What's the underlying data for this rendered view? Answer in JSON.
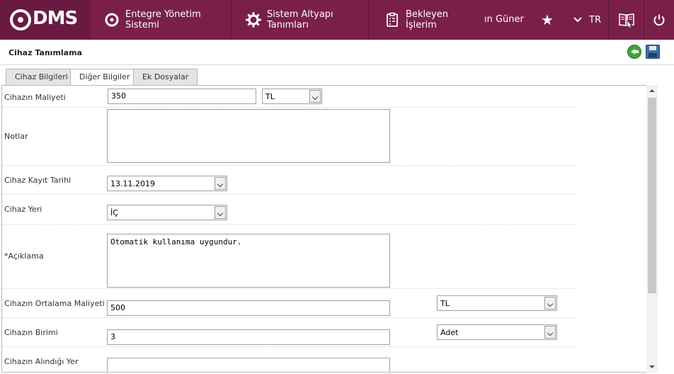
{
  "header": {
    "logo_text": "DMS",
    "nav": [
      {
        "label": "Entegre Yönetim Sistemi",
        "icon": "logo-q-icon"
      },
      {
        "label": "Sistem Altyapı Tanımları",
        "icon": "gear-icon"
      },
      {
        "label": "Bekleyen İşlerim",
        "icon": "clipboard-icon"
      }
    ],
    "user_name": "ın Güner",
    "lang": "TR",
    "colors": {
      "bar": "#7a1f4a",
      "logo_bg": "#6a1a40"
    }
  },
  "page": {
    "title": "Cihaz Tanımlama"
  },
  "tabs": [
    {
      "label": "Cihaz Bilgileri",
      "active": false
    },
    {
      "label": "Diğer Bilgiler",
      "active": true
    },
    {
      "label": "Ek Dosyalar",
      "active": false
    }
  ],
  "form": {
    "maliyet": {
      "label": "Cihazın Maliyeti",
      "value": "350",
      "currency": "TL"
    },
    "notlar": {
      "label": "Notlar",
      "value": ""
    },
    "kayit_tarihi": {
      "label": "Cihaz Kayıt Tarihi",
      "value": "13.11.2019"
    },
    "cihaz_yeri": {
      "label": "Cihaz Yeri",
      "value": "İÇ"
    },
    "aciklama": {
      "label": "*Açıklama",
      "value": "Otomatik kullanıma uygundur."
    },
    "ortalama_maliyet": {
      "label": "Cihazın Ortalama Maliyeti",
      "value": "500",
      "currency": "TL"
    },
    "birimi": {
      "label": "Cihazın Birimi",
      "value": "3",
      "unit": "Adet"
    },
    "alindigi_yer": {
      "label": "Cihazın Alındığı Yer",
      "value": ""
    }
  }
}
